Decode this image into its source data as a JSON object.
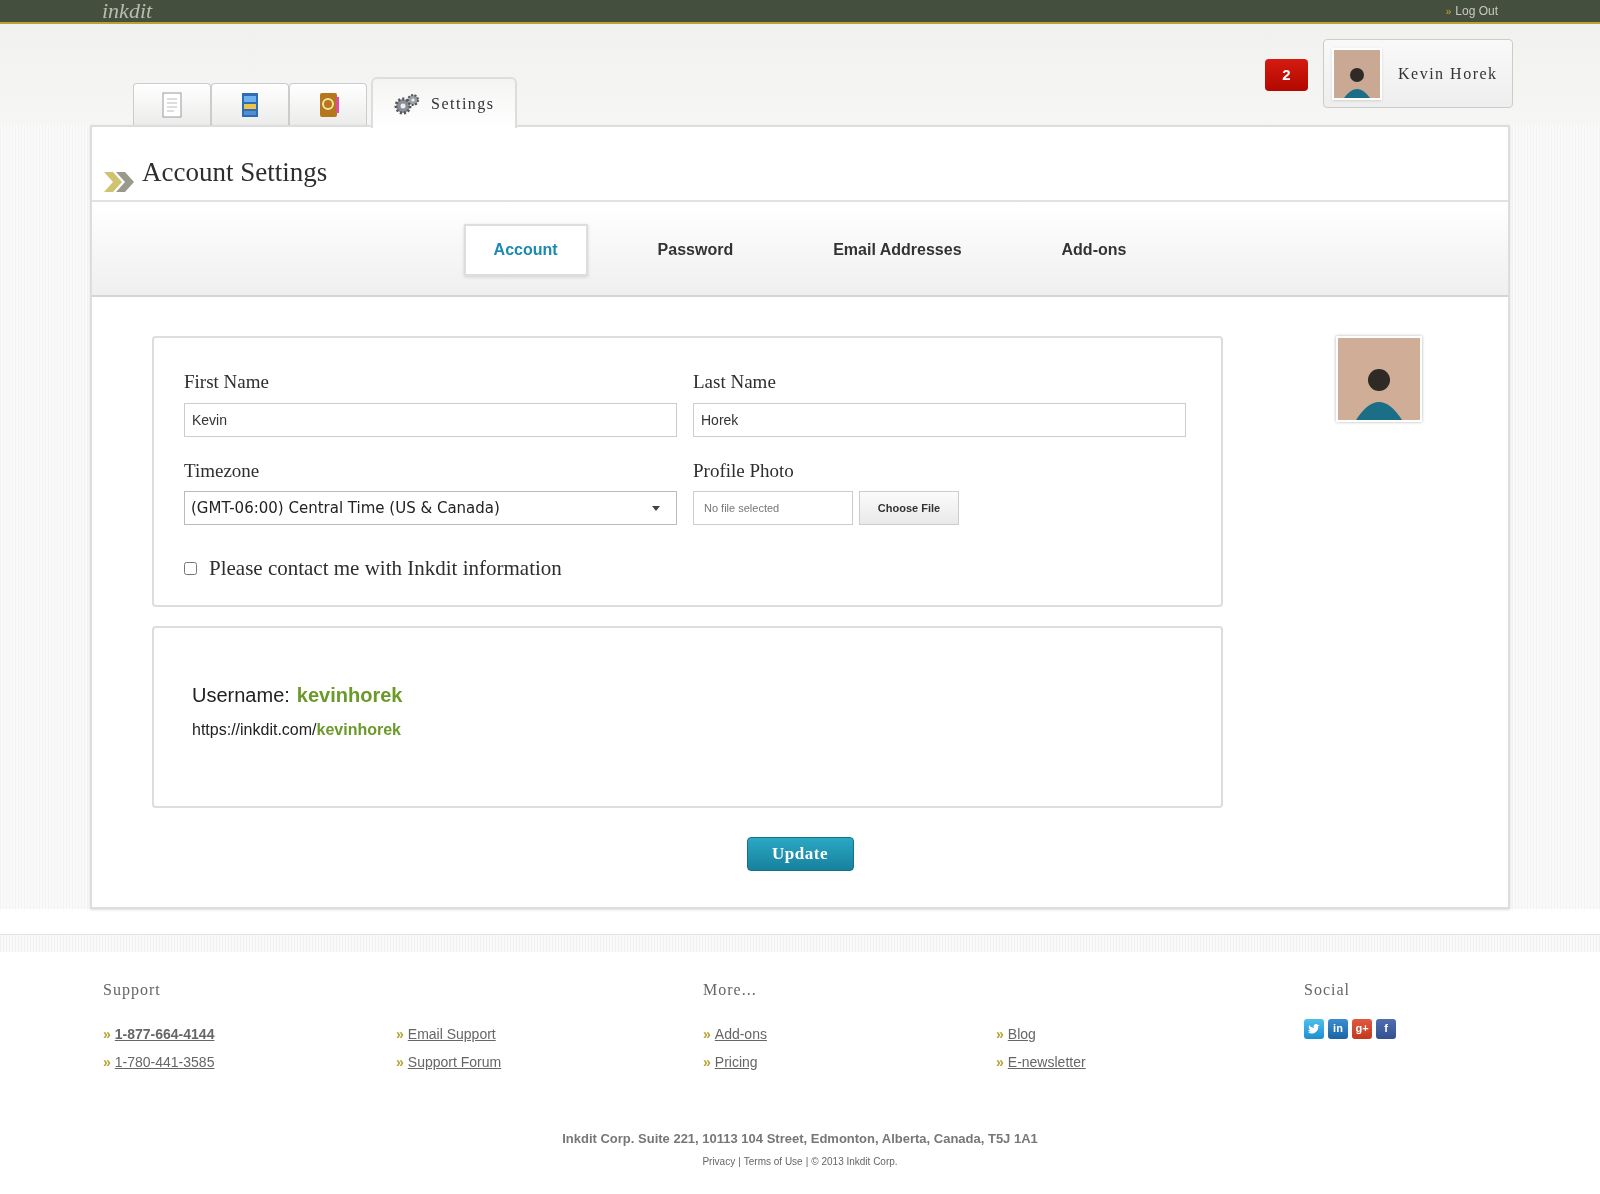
{
  "topbar": {
    "logo": "inkdit",
    "logout": {
      "marker": "»",
      "label": "Log Out"
    }
  },
  "notifications": {
    "count": "2"
  },
  "user": {
    "name": "Kevin Horek"
  },
  "main_tabs": [
    {
      "kind": "document",
      "selected": false
    },
    {
      "kind": "cabinet",
      "selected": false
    },
    {
      "kind": "addressbook",
      "selected": false
    },
    {
      "kind": "settings",
      "label": "Settings",
      "selected": true
    }
  ],
  "page_title": "Account Settings",
  "sub_tabs": [
    {
      "label": "Account",
      "selected": true
    },
    {
      "label": "Password",
      "selected": false
    },
    {
      "label": "Email Addresses",
      "selected": false
    },
    {
      "label": "Add-ons",
      "selected": false
    }
  ],
  "form": {
    "first_name": {
      "label": "First Name",
      "value": "Kevin"
    },
    "last_name": {
      "label": "Last Name",
      "value": "Horek"
    },
    "timezone": {
      "label": "Timezone",
      "value": "(GMT-06:00) Central Time (US & Canada)"
    },
    "profile_photo": {
      "label": "Profile Photo",
      "status": "No file selected",
      "button": "Choose File"
    },
    "contact_opt_in": {
      "label": "Please contact me with Inkdit information",
      "checked": false
    }
  },
  "username": {
    "label": "Username:",
    "value": "kevinhorek",
    "url_prefix": "https://inkdit.com/",
    "url_handle": "kevinhorek"
  },
  "update_button": "Update",
  "footer": {
    "sections": [
      {
        "title": "Support",
        "columns": [
          [
            {
              "marker": "»",
              "label": "1-877-664-4144",
              "emphasized": true
            },
            {
              "marker": "»",
              "label": "1-780-441-3585",
              "emphasized": false
            }
          ],
          [
            {
              "marker": "»",
              "label": "Email Support",
              "emphasized": false
            },
            {
              "marker": "»",
              "label": "Support Forum",
              "emphasized": false
            }
          ]
        ]
      },
      {
        "title": "More...",
        "columns": [
          [
            {
              "marker": "»",
              "label": "Add-ons",
              "emphasized": false
            },
            {
              "marker": "»",
              "label": "Pricing",
              "emphasized": false
            }
          ],
          [
            {
              "marker": "»",
              "label": "Blog",
              "emphasized": false
            },
            {
              "marker": "»",
              "label": "E-newsletter",
              "emphasized": false
            }
          ]
        ]
      }
    ],
    "social": {
      "title": "Social",
      "icons": [
        {
          "kind": "twitter"
        },
        {
          "kind": "linkedin",
          "glyph": "in"
        },
        {
          "kind": "googleplus",
          "glyph": "g+"
        },
        {
          "kind": "facebook",
          "glyph": "f"
        }
      ]
    },
    "address": "Inkdit Corp. Suite 221, 10113 104 Street, Edmonton, Alberta, Canada, T5J 1A1",
    "legal": {
      "links": [
        {
          "label": "Privacy",
          "separator": "|"
        },
        {
          "label": "Terms of Use",
          "separator": "|"
        }
      ],
      "copyright": "© 2013 Inkdit Corp."
    }
  }
}
